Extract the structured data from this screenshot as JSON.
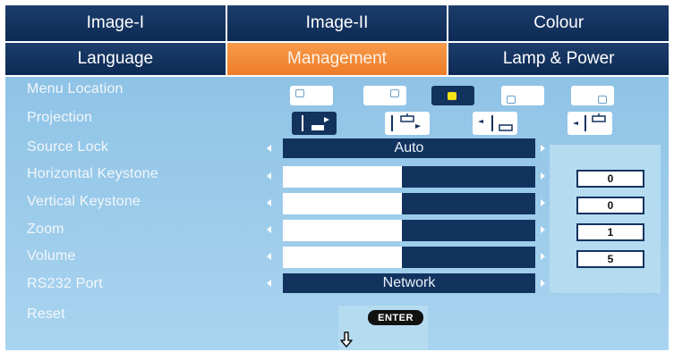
{
  "tabs_row1": [
    "Image-I",
    "Image-II",
    "Colour"
  ],
  "tabs_row2": [
    "Language",
    "Management",
    "Lamp & Power"
  ],
  "active_tab": "Management",
  "items": {
    "menu_location": "Menu Location",
    "projection": "Projection",
    "source_lock": "Source Lock",
    "horizontal_keystone": "Horizontal Keystone",
    "vertical_keystone": "Vertical Keystone",
    "zoom": "Zoom",
    "volume": "Volume",
    "rs232_port": "RS232 Port",
    "reset": "Reset"
  },
  "values": {
    "source_lock": "Auto",
    "horizontal_keystone": "0",
    "vertical_keystone": "0",
    "zoom": "1",
    "volume": "5",
    "rs232_port": "Network",
    "reset_button": "ENTER"
  },
  "menu_location_selected_index": 2,
  "projection_selected_index": 0,
  "slider_levels": {
    "horizontal_keystone": 0.47,
    "vertical_keystone": 0.47,
    "zoom": 0.47,
    "volume": 0.47
  },
  "colors": {
    "tab_bg": "#0d2a55",
    "tab_active": "#ee7d28",
    "panel_bg": "#a9d4ef",
    "control_bg": "#13335f",
    "selected_marker": "#f3e11a"
  },
  "icons": {
    "left_arrow": "triangle-left-icon",
    "right_arrow": "triangle-right-icon",
    "down": "down-arrow-icon"
  }
}
